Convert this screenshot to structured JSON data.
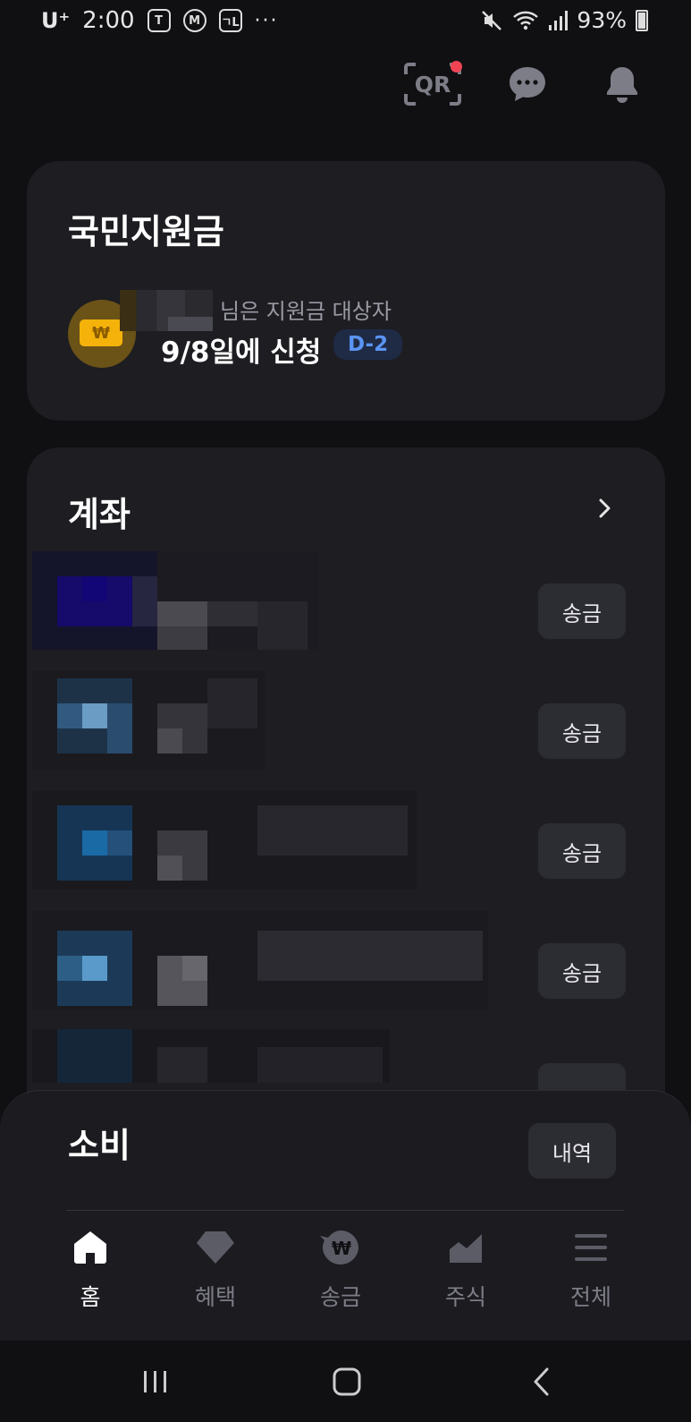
{
  "status_bar": {
    "carrier": "U⁺",
    "time": "2:00",
    "app_badges": [
      "T",
      "M",
      "ㄱL"
    ],
    "more": "···",
    "battery": "93%"
  },
  "header": {
    "qr_label": "QR",
    "icons": [
      "qr-scan-icon",
      "chat-icon",
      "bell-icon"
    ],
    "notification_dot_color": "#f04452"
  },
  "support_card": {
    "title": "국민지원금",
    "subtitle": "님은 지원금 대상자",
    "apply_text": "9/8일에 신청",
    "dday": "D-2",
    "coin_symbol": "₩"
  },
  "accounts_card": {
    "title": "계좌",
    "rows": [
      {
        "send_label": "송금"
      },
      {
        "send_label": "송금"
      },
      {
        "send_label": "송금"
      },
      {
        "send_label": "송금"
      },
      {
        "send_label": ""
      }
    ]
  },
  "spending_sheet": {
    "title": "소비",
    "history_label": "내역"
  },
  "bottom_nav": {
    "items": [
      {
        "label": "홈",
        "icon": "home-icon",
        "active": true
      },
      {
        "label": "혜택",
        "icon": "diamond-icon",
        "active": false
      },
      {
        "label": "송금",
        "icon": "won-icon",
        "active": false
      },
      {
        "label": "주식",
        "icon": "chart-icon",
        "active": false
      },
      {
        "label": "전체",
        "icon": "menu-icon",
        "active": false
      }
    ]
  },
  "colors": {
    "background": "#101013",
    "card": "#1d1d22",
    "accent_blue": "#5a95f5",
    "coin_yellow": "#f4b20a"
  }
}
